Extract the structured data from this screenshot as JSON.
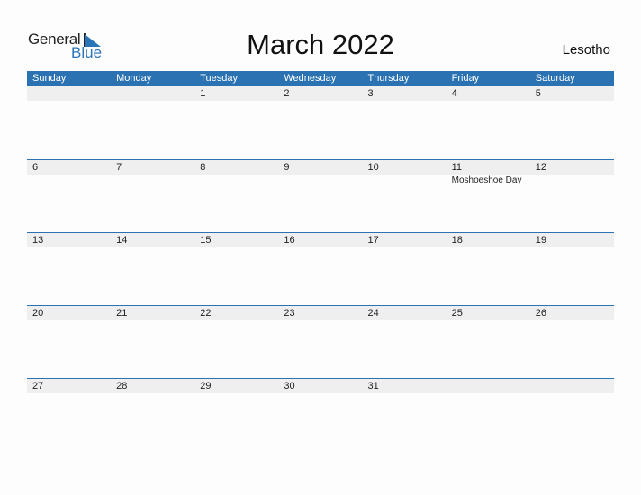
{
  "logo": {
    "part1": "General",
    "part2": "Blue"
  },
  "title": "March 2022",
  "country": "Lesotho",
  "weekdays": [
    "Sunday",
    "Monday",
    "Tuesday",
    "Wednesday",
    "Thursday",
    "Friday",
    "Saturday"
  ],
  "weeks": [
    {
      "dates": [
        "",
        "",
        "1",
        "2",
        "3",
        "4",
        "5"
      ],
      "events": [
        "",
        "",
        "",
        "",
        "",
        "",
        ""
      ]
    },
    {
      "dates": [
        "6",
        "7",
        "8",
        "9",
        "10",
        "11",
        "12"
      ],
      "events": [
        "",
        "",
        "",
        "",
        "",
        "Moshoeshoe Day",
        ""
      ]
    },
    {
      "dates": [
        "13",
        "14",
        "15",
        "16",
        "17",
        "18",
        "19"
      ],
      "events": [
        "",
        "",
        "",
        "",
        "",
        "",
        ""
      ]
    },
    {
      "dates": [
        "20",
        "21",
        "22",
        "23",
        "24",
        "25",
        "26"
      ],
      "events": [
        "",
        "",
        "",
        "",
        "",
        "",
        ""
      ]
    },
    {
      "dates": [
        "27",
        "28",
        "29",
        "30",
        "31",
        "",
        ""
      ],
      "events": [
        "",
        "",
        "",
        "",
        "",
        "",
        ""
      ]
    }
  ],
  "colors": {
    "accent": "#2a72b2",
    "date_strip": "#efefef"
  }
}
